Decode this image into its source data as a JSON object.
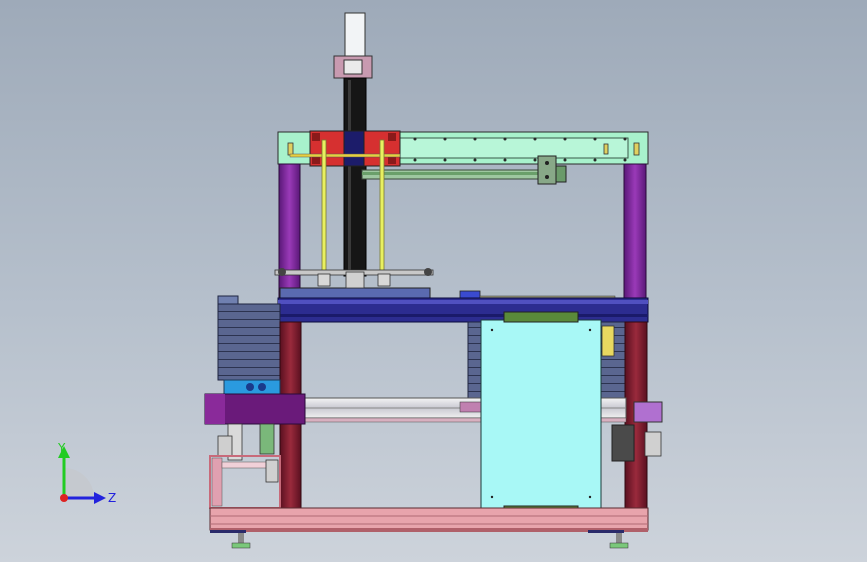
{
  "viewport": {
    "background_top": "#9eaab9",
    "background_bottom": "#cdd3db"
  },
  "triad": {
    "y_label": "Y",
    "z_label": "Z",
    "y_color": "#22cc22",
    "z_color": "#2222dd",
    "x_color": "#dd2222"
  },
  "colors": {
    "frame_purple": "#7a2a9a",
    "frame_maroon": "#7a1e2e",
    "top_rail_mint": "#9ef0c8",
    "carriage_red": "#d02a2a",
    "vertical_column": "#1a1a1a",
    "table_blue": "#2a2a8a",
    "panel_cyan": "#a6f7f7",
    "base_pink": "#e8a0a8",
    "guide_rod_yellow": "#e8f060",
    "motor_purple": "#6a1a7a"
  }
}
